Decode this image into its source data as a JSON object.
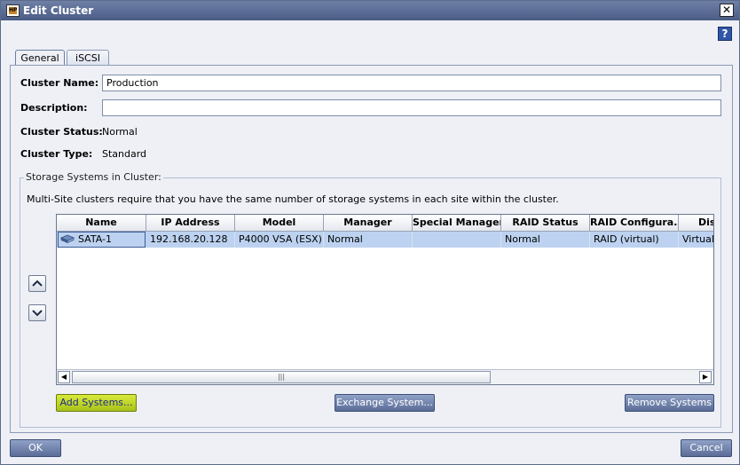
{
  "window": {
    "title": "Edit Cluster",
    "close_label": "✕",
    "help_label": "?"
  },
  "tabs": [
    {
      "label": "General",
      "active": true
    },
    {
      "label": "iSCSI",
      "active": false
    }
  ],
  "form": {
    "cluster_name_label": "Cluster Name:",
    "cluster_name_value": "Production",
    "description_label": "Description:",
    "description_value": "",
    "cluster_status_label": "Cluster Status:",
    "cluster_status_value": "Normal",
    "cluster_type_label": "Cluster Type:",
    "cluster_type_value": "Standard"
  },
  "storage": {
    "group_title": "Storage Systems in Cluster:",
    "note": "Multi-Site clusters require that you have the same number of storage systems in each site within the cluster.",
    "columns": [
      "Name",
      "IP Address",
      "Model",
      "Manager",
      "Special Manager",
      "RAID Status",
      "RAID Configura...",
      "Dis"
    ],
    "rows": [
      {
        "name": "SATA-1",
        "ip": "192.168.20.128",
        "model": "P4000 VSA (ESX)",
        "manager": "Normal",
        "special_manager": "",
        "raid_status": "Normal",
        "raid_config": "RAID (virtual)",
        "dis": "Virtual",
        "icon": "storage-system-icon"
      }
    ],
    "scroll_grip": "|||",
    "add_button": "Add Systems...",
    "exchange_button": "Exchange System...",
    "remove_button": "Remove Systems"
  },
  "footer": {
    "ok_label": "OK",
    "cancel_label": "Cancel"
  },
  "colors": {
    "selected_row": "#bcd2f0",
    "title_bar": "#4a5c86",
    "button": "#6f80a8",
    "highlight_button": "#c2d92a"
  }
}
